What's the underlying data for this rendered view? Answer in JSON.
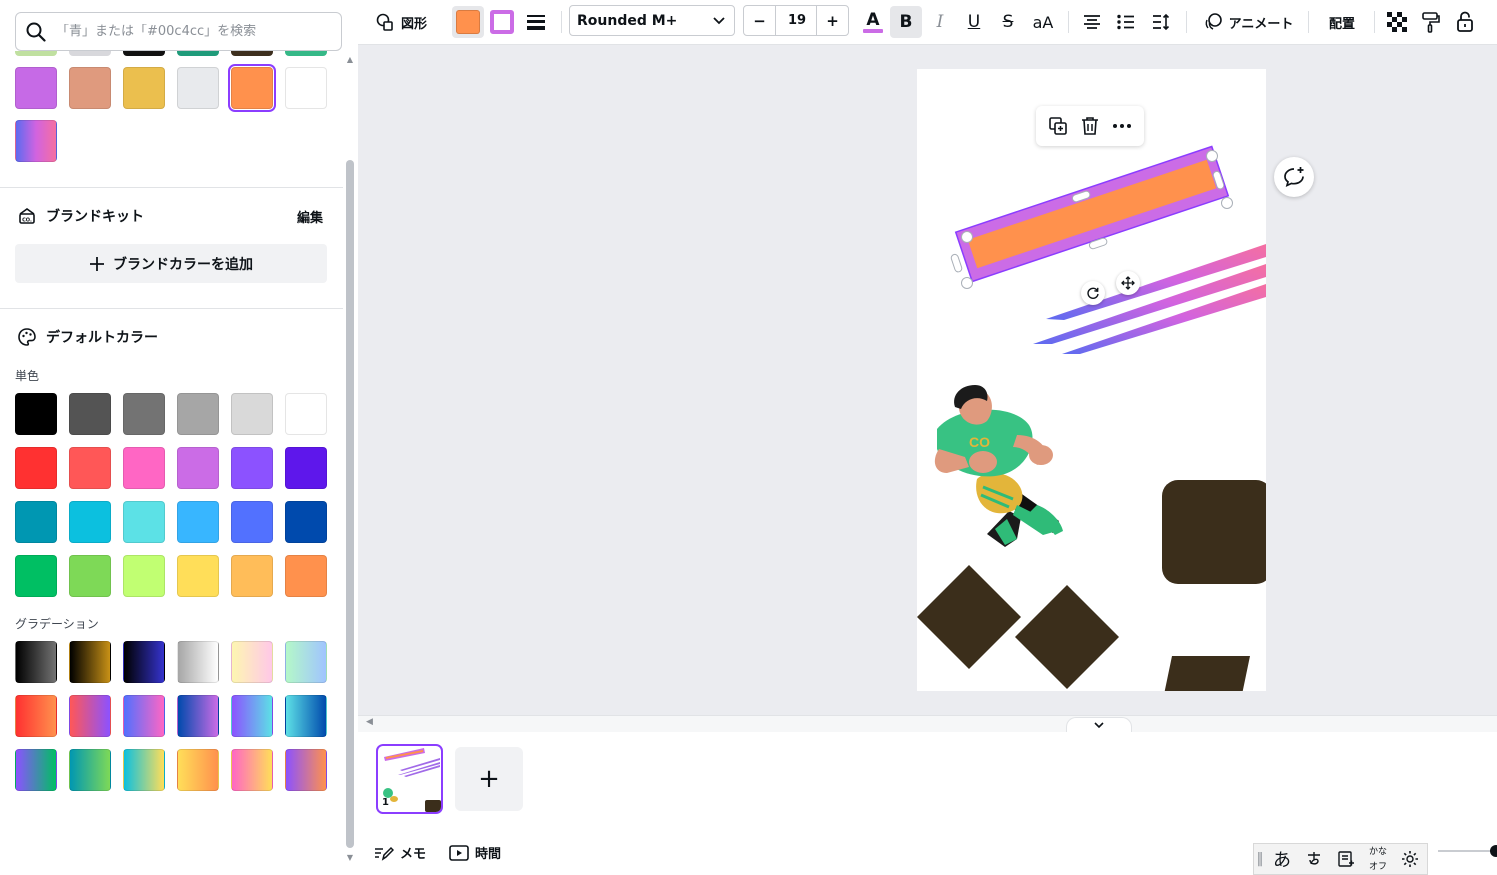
{
  "search": {
    "placeholder": "「青」または「#00c4cc」を検索"
  },
  "document_colors": {
    "peek_colors": [
      "#c0e0a0",
      "#d8d8dc",
      "#111111",
      "#1f9b7a",
      "#3d2f1e",
      "#35b887"
    ],
    "swatches": [
      "#c66ae6",
      "#df9a7e",
      "#ebbf4e",
      "#e8eaed",
      "#ff914d",
      "#ffffff"
    ],
    "selected_index": 4,
    "gradient_swatch": [
      "#5d6bf0",
      "#d163e0",
      "#f56fa1"
    ]
  },
  "brand_kit": {
    "title": "ブランドキット",
    "edit_label": "編集",
    "add_button_label": "ブランドカラーを追加"
  },
  "default_colors": {
    "title": "デフォルトカラー",
    "solid_label": "単色",
    "solid_rows": [
      [
        "#000000",
        "#545454",
        "#737373",
        "#a6a6a6",
        "#d9d9d9",
        "#ffffff"
      ],
      [
        "#ff3131",
        "#ff5757",
        "#ff66c4",
        "#cb6ce6",
        "#8c52ff",
        "#5e17eb"
      ],
      [
        "#0097b2",
        "#0cc0df",
        "#5ce1e6",
        "#38b6ff",
        "#5271ff",
        "#004aad"
      ],
      [
        "#00bf63",
        "#7ed957",
        "#c1ff72",
        "#ffde59",
        "#ffbd59",
        "#ff914d"
      ]
    ],
    "gradient_label": "グラデーション",
    "gradient_rows": [
      [
        [
          "#000000",
          "#737373"
        ],
        [
          "#000000",
          "#c89116"
        ],
        [
          "#000000",
          "#3533cd"
        ],
        [
          "#a6a6a6",
          "#ffffff"
        ],
        [
          "#fdf6b1",
          "#ffc8e8"
        ],
        [
          "#b4f8c8",
          "#a0c4ff"
        ]
      ],
      [
        [
          "#ff3131",
          "#ff914d"
        ],
        [
          "#ff5757",
          "#8c52ff"
        ],
        [
          "#5170ff",
          "#ff66c4"
        ],
        [
          "#004aad",
          "#cb6ce6"
        ],
        [
          "#8c52ff",
          "#5ce1e6"
        ],
        [
          "#5de0e6",
          "#004aad"
        ]
      ],
      [
        [
          "#8c52ff",
          "#00bf63"
        ],
        [
          "#0097b2",
          "#7ed957"
        ],
        [
          "#0cc0df",
          "#ffde59"
        ],
        [
          "#ffde59",
          "#ff914d"
        ],
        [
          "#ff66c4",
          "#ffde59"
        ],
        [
          "#8c52ff",
          "#ff914d"
        ]
      ]
    ]
  },
  "toolbar": {
    "shape_label": "図形",
    "fill_color": "#ff914d",
    "border_color": "#cb6ce6",
    "font_name": "Rounded M+",
    "font_size": "19",
    "minus_label": "−",
    "plus_label": "+",
    "text_color_accent": "#cb6ce6",
    "bold_label": "B",
    "italic_label": "I",
    "underline_label": "U",
    "strike_label": "S",
    "case_label": "aA",
    "animate_label": "アニメート",
    "position_label": "配置"
  },
  "design": {
    "shape_border_color": "#cb6ce6",
    "shape_fill_color": "#ff914d",
    "dark_shape_color": "#3b2e1b",
    "stripe_gradient": [
      "#5d6bf0",
      "#d163e0",
      "#f56fa1"
    ]
  },
  "pages": {
    "current_page_number": "1",
    "add_page_label": "+"
  },
  "bottom": {
    "notes_label": "メモ",
    "timing_label": "時間"
  },
  "ime": {
    "hiragana_label": "あ",
    "kana_label_top": "かな",
    "kana_label_bottom": "オフ"
  }
}
